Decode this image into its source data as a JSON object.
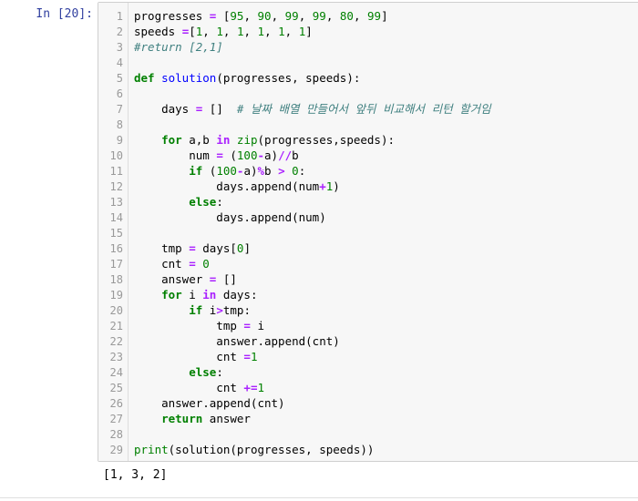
{
  "prompt": "In [20]:",
  "output": "[1, 3, 2]",
  "lines": [
    "1",
    "2",
    "3",
    "4",
    "5",
    "6",
    "7",
    "8",
    "9",
    "10",
    "11",
    "12",
    "13",
    "14",
    "15",
    "16",
    "17",
    "18",
    "19",
    "20",
    "21",
    "22",
    "23",
    "24",
    "25",
    "26",
    "27",
    "28",
    "29"
  ],
  "code": {
    "l1_a": "progresses ",
    "l1_b": "=",
    "l1_c": " [",
    "l1_d": "95",
    "l1_e": ", ",
    "l1_f": "90",
    "l1_g": ", ",
    "l1_h": "99",
    "l1_i": ", ",
    "l1_j": "99",
    "l1_k": ", ",
    "l1_l": "80",
    "l1_m": ", ",
    "l1_n": "99",
    "l1_o": "]",
    "l2_a": "speeds ",
    "l2_b": "=",
    "l2_c": "[",
    "l2_d": "1",
    "l2_e": ", ",
    "l2_f": "1",
    "l2_g": ", ",
    "l2_h": "1",
    "l2_i": ", ",
    "l2_j": "1",
    "l2_k": ", ",
    "l2_l": "1",
    "l2_m": ", ",
    "l2_n": "1",
    "l2_o": "]",
    "l3": "#return [2,1]",
    "l5_a": "def",
    "l5_b": " ",
    "l5_c": "solution",
    "l5_d": "(progresses, speeds):",
    "l7_a": "    days ",
    "l7_b": "=",
    "l7_c": " []  ",
    "l7_d": "# 날짜 배열 만들어서 앞뒤 비교해서 리턴 할거임",
    "l9_a": "    ",
    "l9_b": "for",
    "l9_c": " a,b ",
    "l9_d": "in",
    "l9_e": " ",
    "l9_f": "zip",
    "l9_g": "(progresses,speeds):",
    "l10_a": "        num ",
    "l10_b": "=",
    "l10_c": " (",
    "l10_d": "100",
    "l10_e": "-",
    "l10_f": "a)",
    "l10_g": "//",
    "l10_h": "b",
    "l11_a": "        ",
    "l11_b": "if",
    "l11_c": " (",
    "l11_d": "100",
    "l11_e": "-",
    "l11_f": "a)",
    "l11_g": "%",
    "l11_h": "b ",
    "l11_i": ">",
    "l11_j": " ",
    "l11_k": "0",
    "l11_l": ":",
    "l12_a": "            days.append(num",
    "l12_b": "+",
    "l12_c": "1",
    "l12_d": ")",
    "l13_a": "        ",
    "l13_b": "else",
    "l13_c": ":",
    "l14": "            days.append(num)",
    "l16_a": "    tmp ",
    "l16_b": "=",
    "l16_c": " days[",
    "l16_d": "0",
    "l16_e": "]",
    "l17_a": "    cnt ",
    "l17_b": "=",
    "l17_c": " ",
    "l17_d": "0",
    "l18_a": "    answer ",
    "l18_b": "=",
    "l18_c": " []",
    "l19_a": "    ",
    "l19_b": "for",
    "l19_c": " i ",
    "l19_d": "in",
    "l19_e": " days:",
    "l20_a": "        ",
    "l20_b": "if",
    "l20_c": " i",
    "l20_d": ">",
    "l20_e": "tmp:",
    "l21_a": "            tmp ",
    "l21_b": "=",
    "l21_c": " i",
    "l22": "            answer.append(cnt)",
    "l23_a": "            cnt ",
    "l23_b": "=",
    "l23_c": "1",
    "l24_a": "        ",
    "l24_b": "else",
    "l24_c": ":",
    "l25_a": "            cnt ",
    "l25_b": "+=",
    "l25_c": "1",
    "l26": "    answer.append(cnt)",
    "l27_a": "    ",
    "l27_b": "return",
    "l27_c": " answer",
    "l29_a": "print",
    "l29_b": "(solution(progresses, speeds))"
  }
}
